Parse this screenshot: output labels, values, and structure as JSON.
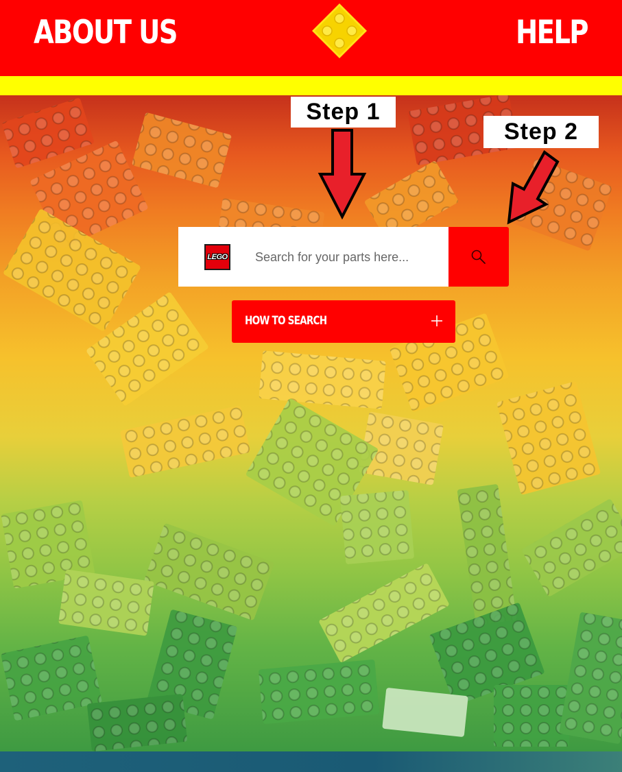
{
  "header": {
    "about_label": "ABOUT US",
    "help_label": "HELP",
    "logo_icon": "lego-brick-diamond-icon"
  },
  "colors": {
    "brand_red": "#ff0000",
    "accent_yellow": "#ffff00",
    "footer_teal": "#1d5d73"
  },
  "annotations": {
    "step1": "Step 1",
    "step2": "Step 2"
  },
  "search": {
    "brand_badge": "LEGO",
    "placeholder": "Search for your parts here...",
    "value": "",
    "button_icon": "search-icon"
  },
  "how_to": {
    "label": "HOW TO SEARCH",
    "icon": "plus-icon"
  }
}
